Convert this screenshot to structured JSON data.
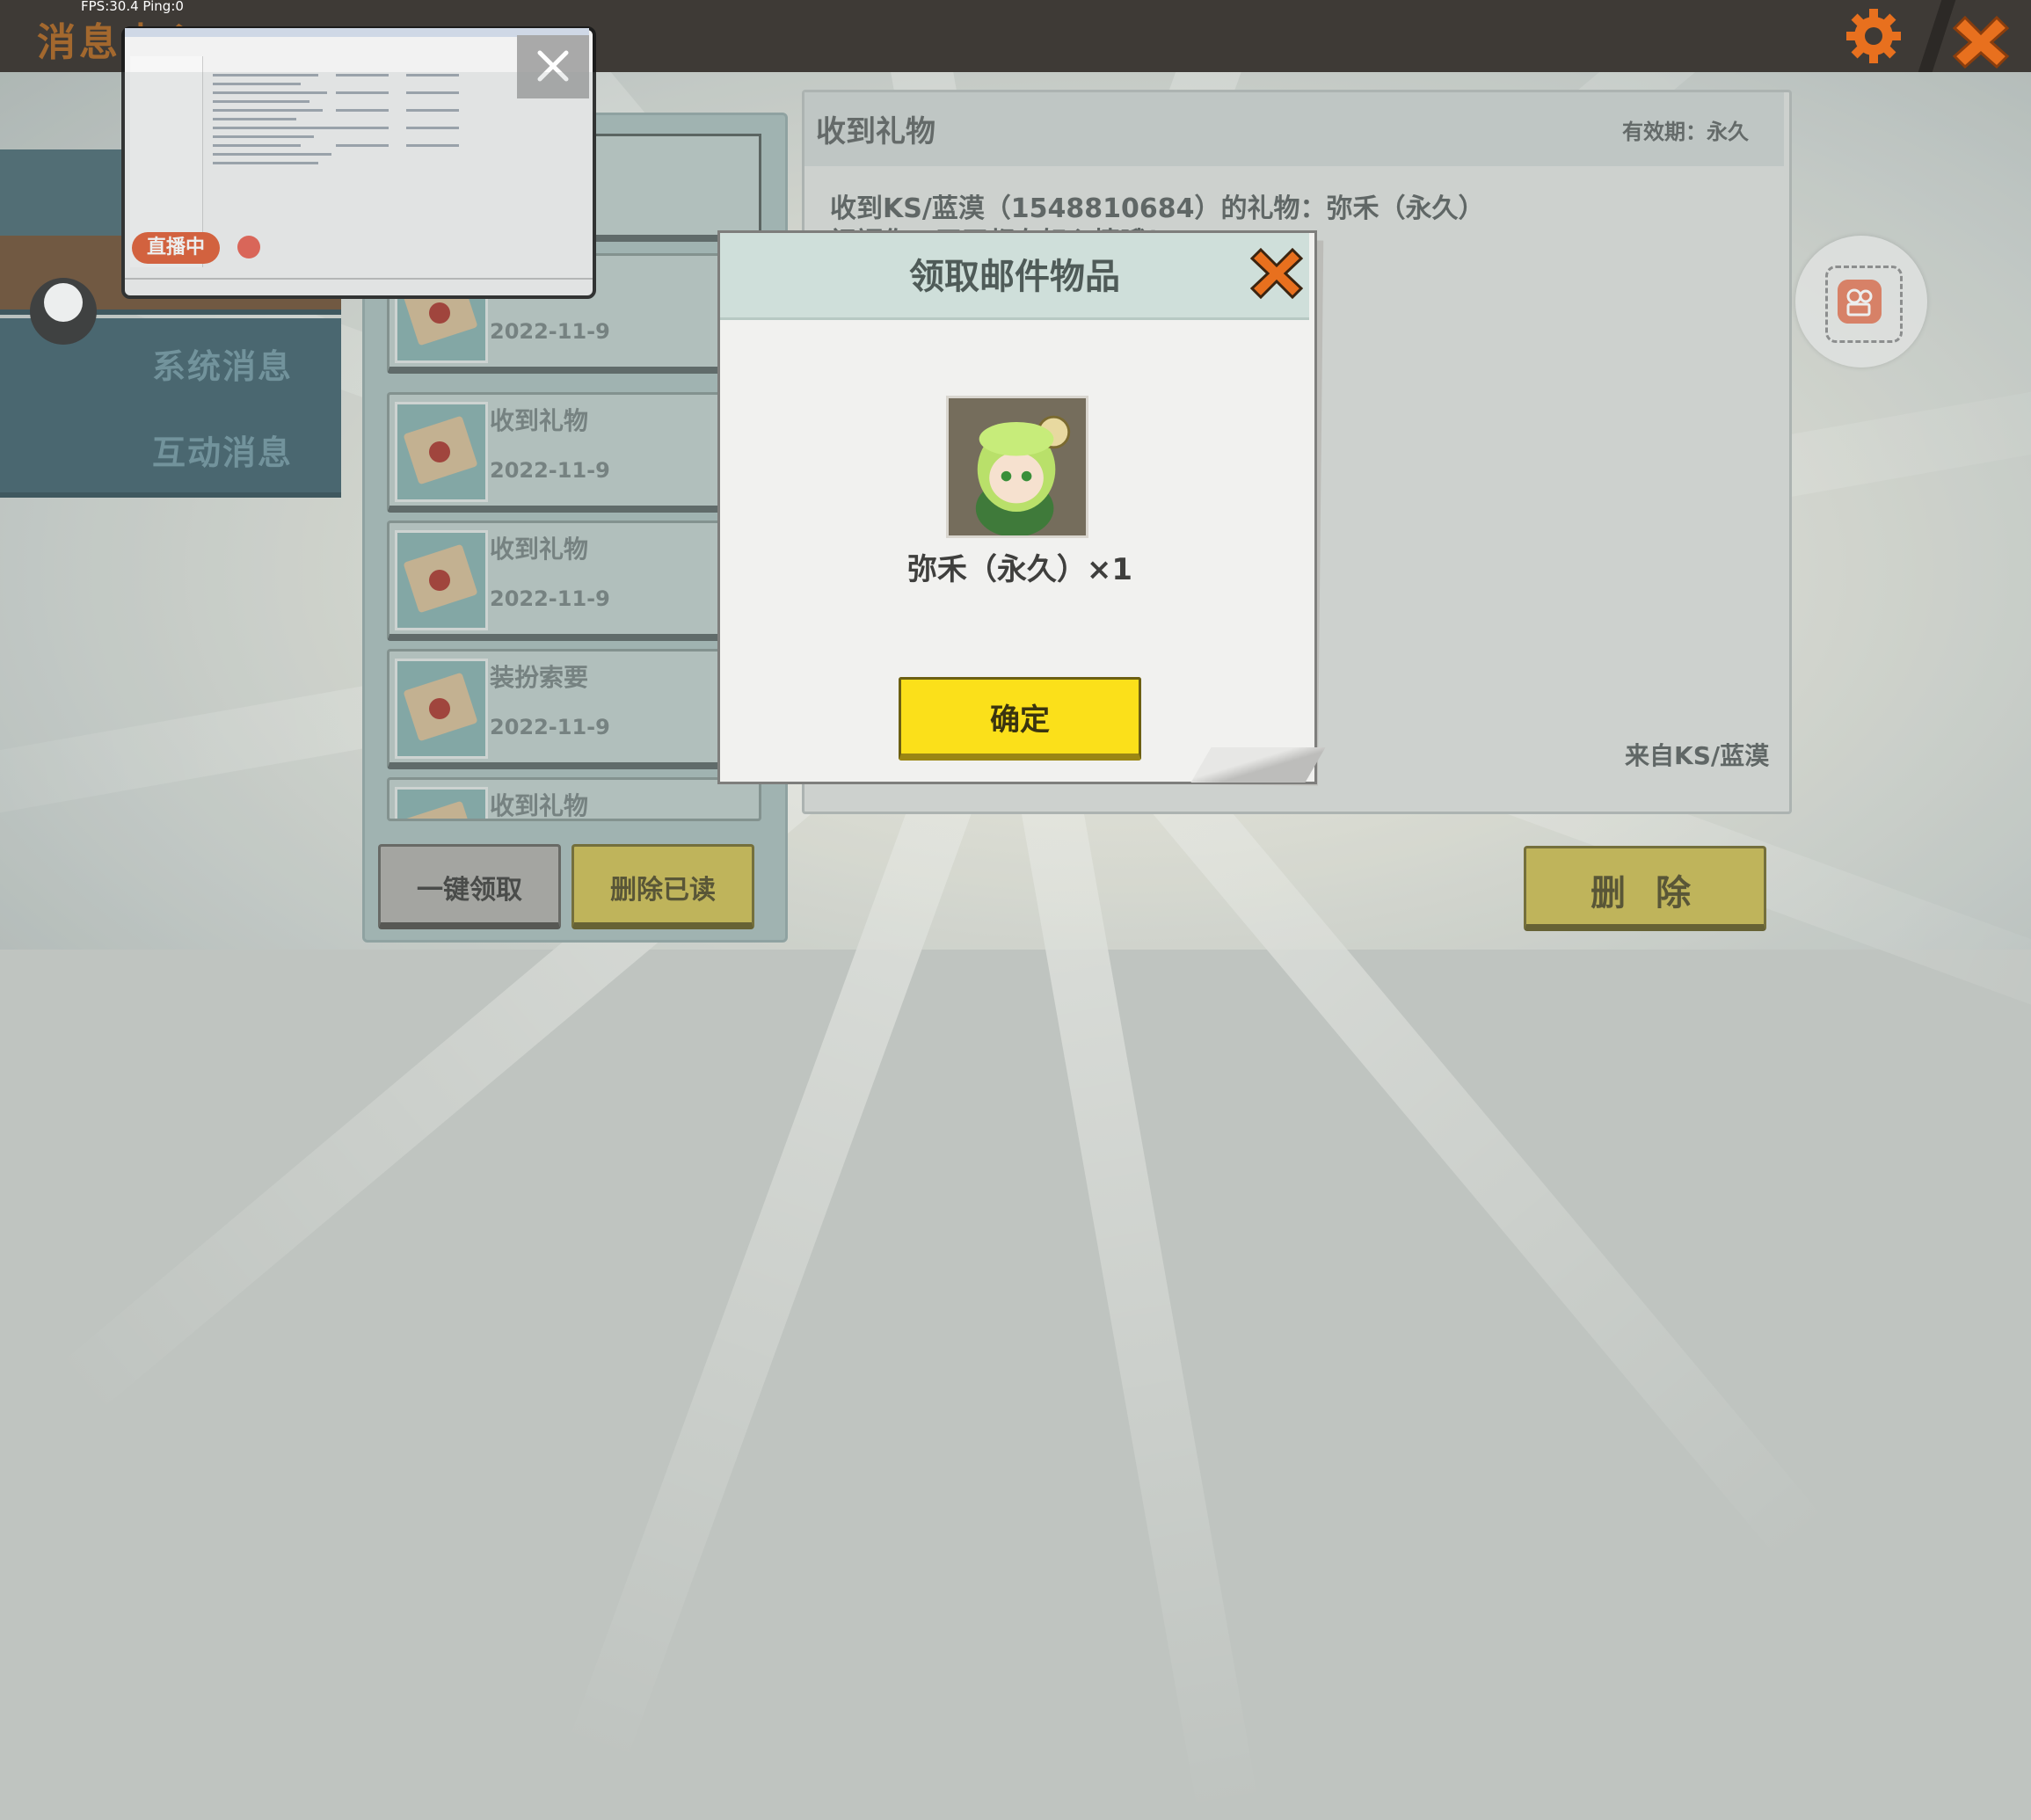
{
  "hud": {
    "fps": "FPS:30.4  Ping:0"
  },
  "header": {
    "title": "消息中心"
  },
  "tabs": [
    {
      "label": ""
    },
    {
      "label": ""
    },
    {
      "label": "系统消息"
    },
    {
      "label": "互动消息"
    }
  ],
  "mail_list": [
    {
      "title": "",
      "date": "2022-11-9"
    },
    {
      "title": "收到礼物",
      "date": "2022-11-9"
    },
    {
      "title": "收到礼物",
      "date": "2022-11-9"
    },
    {
      "title": "装扮索要",
      "date": "2022-11-9"
    },
    {
      "title": "收到礼物",
      "date": ""
    }
  ],
  "list_buttons": {
    "claim_all": "一键领取",
    "delete_read": "删除已读"
  },
  "detail": {
    "title": "收到礼物",
    "validity": "有效期：永久",
    "body": "收到KS/蓝漠（1548810684）的礼物：弥禾（永久）",
    "body2": "祝福你，天天都有好心情哦！",
    "from": "来自KS/蓝漠",
    "delete_label": "删 除"
  },
  "modal": {
    "title": "领取邮件物品",
    "item_name": "弥禾（永久）×1",
    "confirm_label": "确定"
  },
  "overlay": {
    "live_label": "直播中"
  },
  "colors": {
    "accent_yellow": "#fbe01a",
    "header_dark": "#3e3a36",
    "tab_teal": "#3a5b66",
    "close_orange": "#e8701e"
  }
}
